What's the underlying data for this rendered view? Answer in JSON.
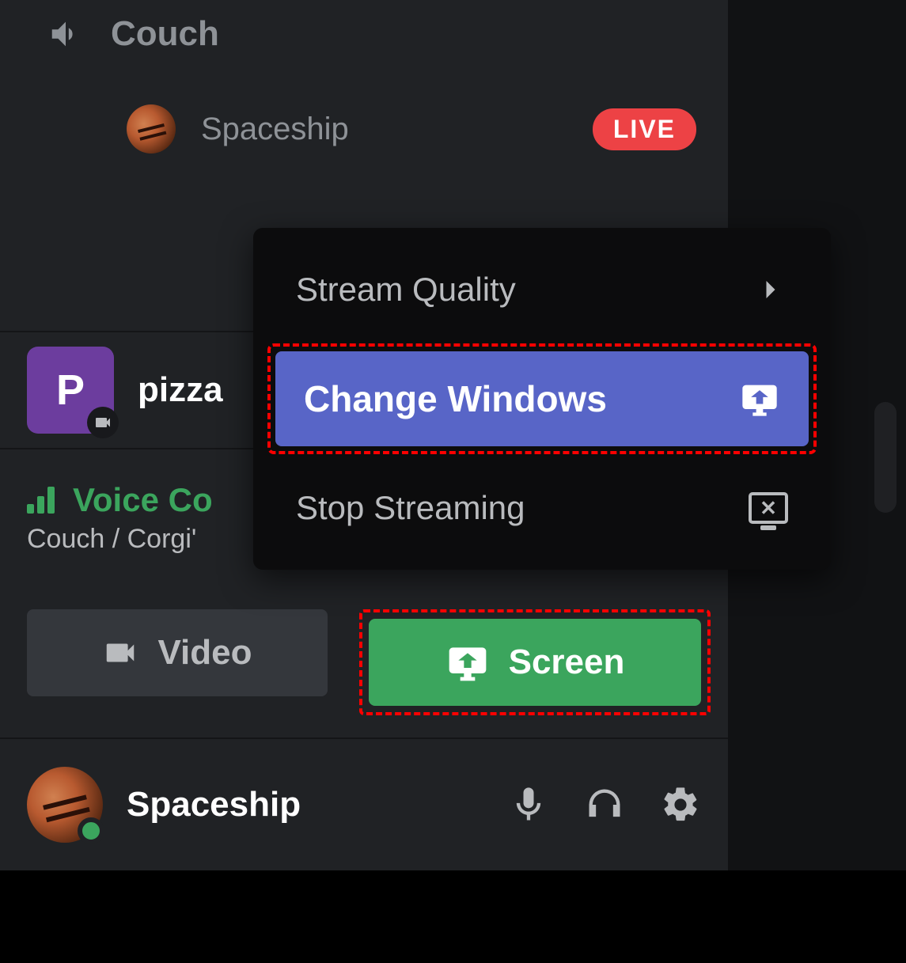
{
  "channel": {
    "name": "Couch"
  },
  "member": {
    "name": "Spaceship",
    "live_badge": "LIVE"
  },
  "activity": {
    "tile_letter": "P",
    "label": "pizza"
  },
  "voice": {
    "status": "Voice Co",
    "path": "Couch / Corgi'"
  },
  "buttons": {
    "video": "Video",
    "screen": "Screen"
  },
  "popup": {
    "stream_quality": "Stream Quality",
    "change_windows": "Change Windows",
    "stop_streaming": "Stop Streaming"
  },
  "user": {
    "name": "Spaceship"
  }
}
